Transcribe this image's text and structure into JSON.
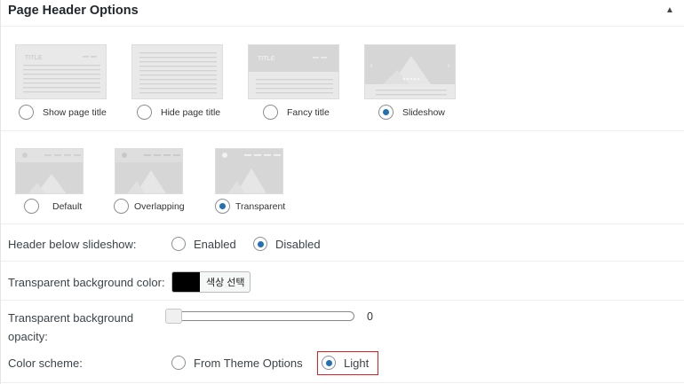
{
  "header": {
    "title": "Page Header Options",
    "toggle_icon": "triangle-up-icon"
  },
  "title_styles": {
    "options": [
      {
        "label": "Show page title",
        "checked": false
      },
      {
        "label": "Hide page title",
        "checked": false
      },
      {
        "label": "Fancy title",
        "checked": false
      },
      {
        "label": "Slideshow",
        "checked": true
      }
    ],
    "thumb_text": "TITLE"
  },
  "header_styles": {
    "options": [
      {
        "label": "Default",
        "checked": false
      },
      {
        "label": "Overlapping",
        "checked": false
      },
      {
        "label": "Transparent",
        "checked": true
      }
    ]
  },
  "header_below_slideshow": {
    "label": "Header below slideshow:",
    "options": [
      {
        "label": "Enabled",
        "checked": false
      },
      {
        "label": "Disabled",
        "checked": true
      }
    ]
  },
  "transparent_bg_color": {
    "label": "Transparent background color:",
    "swatch_color": "#000000",
    "button_label": "색상 선택"
  },
  "transparent_bg_opacity": {
    "label_line1": "Transparent background",
    "label_line2": "opacity:",
    "value": "0"
  },
  "color_scheme": {
    "label": "Color scheme:",
    "options": [
      {
        "label": "From Theme Options",
        "checked": false
      },
      {
        "label": "Light",
        "checked": true
      }
    ],
    "highlight_color": "#e0201f"
  },
  "colors": {
    "accent": "#2271b1",
    "thumb_bg": "#e9e9e9",
    "thumb_line": "#cfcfcf"
  }
}
